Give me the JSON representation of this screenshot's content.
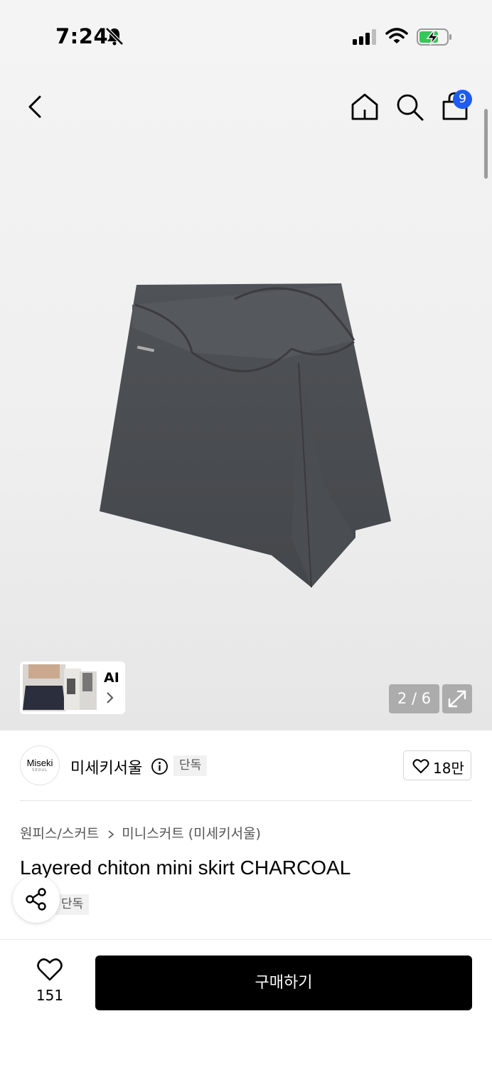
{
  "status_bar": {
    "time": "7:24",
    "icons": [
      "bell-slash-icon",
      "cellular-signal-icon",
      "wifi-icon",
      "battery-charging-icon"
    ]
  },
  "nav": {
    "icons": [
      "back-arrow-icon",
      "home-icon",
      "search-icon",
      "shopping-bag-icon"
    ],
    "cart_badge": "9"
  },
  "gallery": {
    "product_image": "skirt-photo",
    "ai_label": "AI",
    "pager": "2 / 6",
    "expand_icon": "expand-icon"
  },
  "brand": {
    "logo_text": "Miseki",
    "logo_subtext": "SEOUL",
    "name": "미세키서울",
    "tag": "단독",
    "likes": "18만"
  },
  "product": {
    "breadcrumb": [
      "원피스/스커트",
      "미니스커트 (미세키서울)"
    ],
    "title": "Layered chiton mini skirt CHARCOAL",
    "tag": "단독"
  },
  "bottom_bar": {
    "wish_count": "151",
    "buy_label": "구매하기"
  },
  "colors": {
    "accent_badge": "#1e5bf0",
    "buy_button": "#000000",
    "battery_charge": "#34c759"
  }
}
